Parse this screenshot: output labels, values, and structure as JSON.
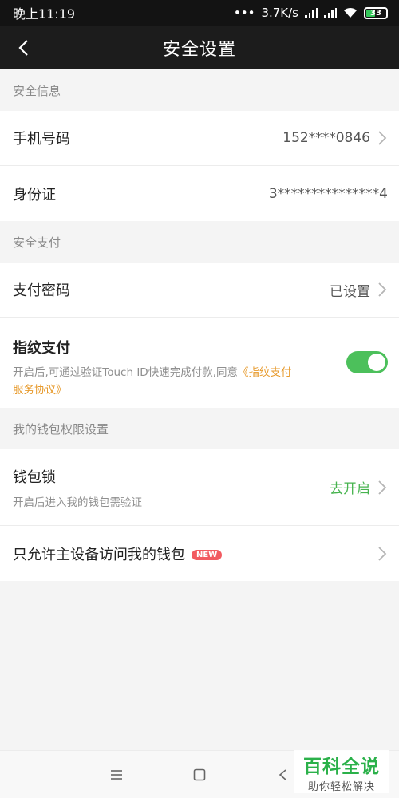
{
  "status_bar": {
    "time": "晚上11:19",
    "network_speed": "3.7K/s",
    "battery": "33"
  },
  "nav": {
    "title": "安全设置"
  },
  "sections": {
    "info_header": "安全信息",
    "pay_header": "安全支付",
    "wallet_header": "我的钱包权限设置"
  },
  "rows": {
    "phone": {
      "label": "手机号码",
      "value": "152****0846"
    },
    "id_card": {
      "label": "身份证",
      "value": "3***************4"
    },
    "pay_password": {
      "label": "支付密码",
      "value": "已设置"
    },
    "fingerprint": {
      "label": "指纹支付",
      "desc": "开启后,可通过验证Touch ID快速完成付款,同意",
      "link": "《指纹支付服务协议》",
      "enabled": true
    },
    "wallet_lock": {
      "label": "钱包锁",
      "sub": "开启后进入我的钱包需验证",
      "action": "去开启"
    },
    "main_device": {
      "label": "只允许主设备访问我的钱包",
      "badge": "NEW"
    }
  },
  "watermark": {
    "title": "百科全说",
    "subtitle": "助你轻松解决"
  },
  "colors": {
    "accent_green": "#46b34e",
    "link_orange": "#e79a2c",
    "badge_red": "#f25a60",
    "nav_bg": "#1c1c1c"
  }
}
